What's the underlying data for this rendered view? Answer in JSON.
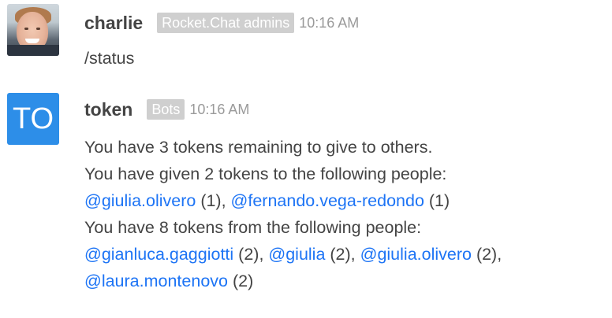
{
  "messages": [
    {
      "username": "charlie",
      "role": "Rocket.Chat admins",
      "time": "10:16 AM",
      "text": "/status"
    },
    {
      "username": "token",
      "role": "Bots",
      "time": "10:16 AM",
      "avatar_initials": "TO",
      "avatar_color": "#2d8ee8",
      "lines": {
        "remaining": "You have 3 tokens remaining to give to others.",
        "given_intro": "You have given 2 tokens to the following people:",
        "given": [
          {
            "mention": "@giulia.olivero",
            "count": " (1)",
            "sep": ", "
          },
          {
            "mention": "@fernando.vega-redondo",
            "count": " (1)",
            "sep": ""
          }
        ],
        "received_intro": "You have 8 tokens from the following people:",
        "received": [
          {
            "mention": "@gianluca.gaggiotti",
            "count": " (2)",
            "sep": ", "
          },
          {
            "mention": "@giulia",
            "count": " (2)",
            "sep": ", "
          },
          {
            "mention": "@giulia.olivero",
            "count": " (2)",
            "sep": ","
          },
          {
            "mention": "@laura.montenovo",
            "count": " (2)",
            "sep": ""
          }
        ]
      }
    }
  ],
  "colors": {
    "mention": "#1d74f5",
    "role_badge_bg": "#cfcfcf",
    "text": "#444444",
    "time": "#9a9a9a"
  }
}
